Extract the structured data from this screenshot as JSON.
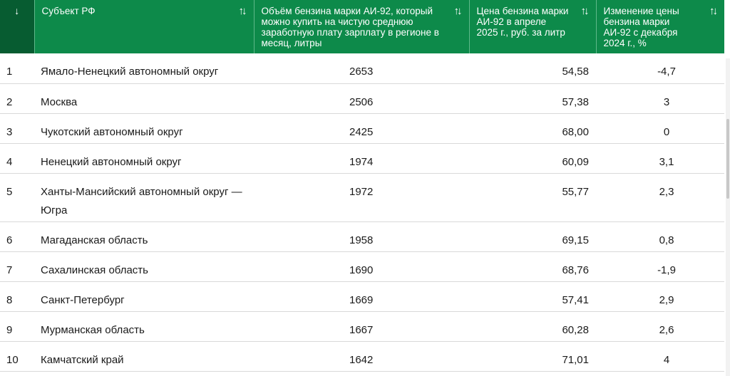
{
  "header": {
    "index_icon": "arrow-down-icon",
    "columns": [
      {
        "label": "Субъект РФ"
      },
      {
        "label": "Объём бензина марки АИ-92, который можно купить на чистую среднюю заработную плату зарплату в регионе в месяц, литры"
      },
      {
        "label": "Цена бензина марки АИ-92 в апреле 2025 г., руб. за литр"
      },
      {
        "label": "Изменение цены бензина марки АИ-92 с декабря 2024 г., %"
      }
    ],
    "sort_icon_glyph": "↑↓",
    "down_icon_glyph": "↓"
  },
  "rows": [
    {
      "n": "1",
      "subject": "Ямало-Ненецкий автономный округ",
      "liters": "2653",
      "price": "54,58",
      "change": "-4,7"
    },
    {
      "n": "2",
      "subject": "Москва",
      "liters": "2506",
      "price": "57,38",
      "change": "3"
    },
    {
      "n": "3",
      "subject": "Чукотский автономный округ",
      "liters": "2425",
      "price": "68,00",
      "change": "0"
    },
    {
      "n": "4",
      "subject": "Ненецкий автономный округ",
      "liters": "1974",
      "price": "60,09",
      "change": "3,1"
    },
    {
      "n": "5",
      "subject": "Ханты-Мансийский автономный округ — Югра",
      "liters": "1972",
      "price": "55,77",
      "change": "2,3"
    },
    {
      "n": "6",
      "subject": "Магаданская область",
      "liters": "1958",
      "price": "69,15",
      "change": "0,8"
    },
    {
      "n": "7",
      "subject": "Сахалинская область",
      "liters": "1690",
      "price": "68,76",
      "change": "-1,9"
    },
    {
      "n": "8",
      "subject": "Санкт-Петербург",
      "liters": "1669",
      "price": "57,41",
      "change": "2,9"
    },
    {
      "n": "9",
      "subject": "Мурманская область",
      "liters": "1667",
      "price": "60,28",
      "change": "2,6"
    },
    {
      "n": "10",
      "subject": "Камчатский край",
      "liters": "1642",
      "price": "71,01",
      "change": "4"
    }
  ],
  "colors": {
    "header_bg": "#0d8a4a",
    "index_header_bg": "#075c31",
    "header_text": "#ffffff"
  }
}
